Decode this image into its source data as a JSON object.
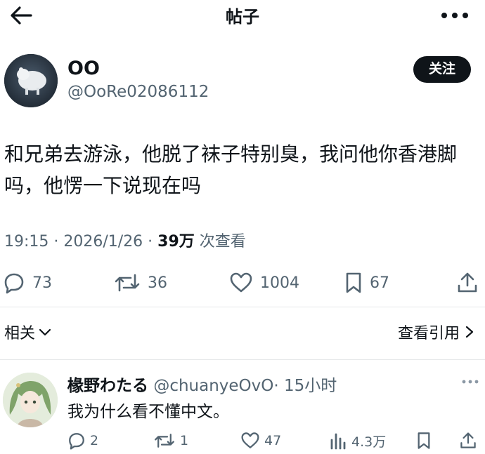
{
  "header": {
    "title": "帖子",
    "back_icon": "arrow-left-icon",
    "more_icon": "more-horizontal-icon"
  },
  "post": {
    "author_name": "OO",
    "author_handle": "@OoRe02086112",
    "follow_label": "关注",
    "text": "和兄弟去游泳，他脱了袜子特别臭，我问他你香港脚吗，他愣一下说现在吗",
    "time": "19:15 · 2026/1/26 · ",
    "views": "39万",
    "views_suffix": " 次查看",
    "actions": {
      "replies": "73",
      "reposts": "36",
      "likes": "1004",
      "bookmarks": "67"
    }
  },
  "related_label": "相关",
  "quotes_label": "查看引用",
  "reply": {
    "author_name": "椽野わたる",
    "author_handle": "@chuanyeOvO",
    "time": "· 15小时",
    "text": "我为什么看不懂中文。",
    "actions": {
      "replies": "2",
      "reposts": "1",
      "likes": "47",
      "views": "4.3万"
    }
  }
}
